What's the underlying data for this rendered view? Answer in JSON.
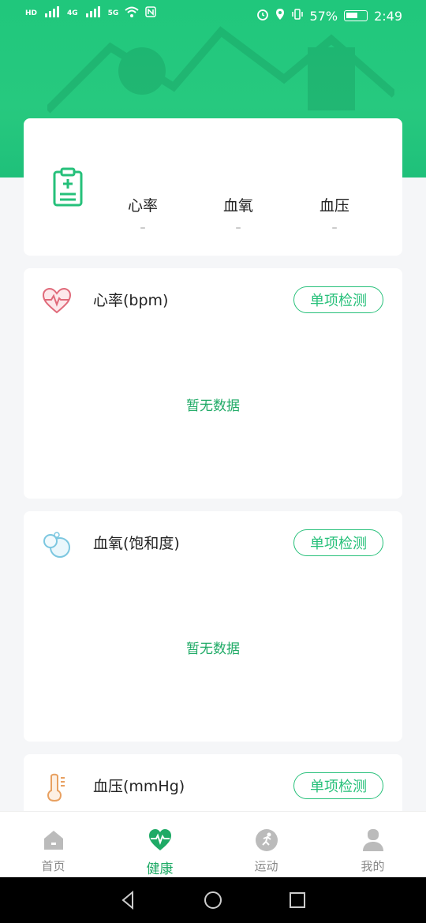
{
  "status_bar": {
    "left_labels": [
      "HD",
      "4G",
      "5G"
    ],
    "battery_percent": "57%",
    "time": "2:49"
  },
  "summary": {
    "metrics": [
      {
        "label": "心率",
        "value": "–"
      },
      {
        "label": "血氧",
        "value": "–"
      },
      {
        "label": "血压",
        "value": "–"
      }
    ]
  },
  "sections": [
    {
      "title": "心率(bpm)",
      "button": "单项检测",
      "empty": "暂无数据",
      "icon": "heart-pulse-icon"
    },
    {
      "title": "血氧(饱和度)",
      "button": "单项检测",
      "empty": "暂无数据",
      "icon": "bubbles-icon"
    },
    {
      "title": "血压(mmHg)",
      "button": "单项检测",
      "icon": "thermometer-icon"
    }
  ],
  "bottom_nav": {
    "items": [
      {
        "label": "首页",
        "icon": "home-icon",
        "active": false
      },
      {
        "label": "健康",
        "icon": "health-heart-icon",
        "active": true
      },
      {
        "label": "运动",
        "icon": "running-icon",
        "active": false
      },
      {
        "label": "我的",
        "icon": "profile-icon",
        "active": false
      }
    ]
  },
  "colors": {
    "brand_green": "#20c77c",
    "accent_text": "#1faa66"
  }
}
